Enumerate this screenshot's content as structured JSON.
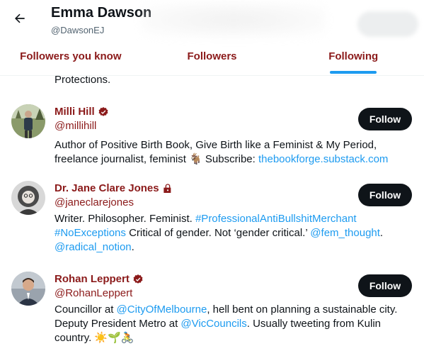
{
  "header": {
    "title": "Emma Dawson",
    "handle": "@DawsonEJ"
  },
  "tabs": [
    {
      "label": "Followers you know",
      "active": false
    },
    {
      "label": "Followers",
      "active": false
    },
    {
      "label": "Following",
      "active": true
    }
  ],
  "list": {
    "continued_text": "Protections.",
    "users": [
      {
        "name": "Milli Hill",
        "handle": "@millihill",
        "badge": "verified-icon",
        "follow_label": "Follow",
        "bio": {
          "text1": "Author of Positive Birth Book, Give Birth like a Feminist & My Period,",
          "text2": "freelance journalist, feminist 🐐 Subscribe: ",
          "link1": "thebookforge.substack.com"
        }
      },
      {
        "name": "Dr. Jane Clare Jones",
        "handle": "@janeclarejones",
        "badge": "lock-icon",
        "follow_label": "Follow",
        "bio": {
          "text1": "Writer. Philosopher. Feminist. ",
          "link1": "#ProfessionalAntiBullshitMerchant",
          "link2": "#NoExceptions",
          "text2": " Critical of gender. Not ‘gender critical.’ ",
          "link3": "@fem_thought",
          "text3": ".",
          "link4": "@radical_notion",
          "text4": "."
        }
      },
      {
        "name": "Rohan Leppert",
        "handle": "@RohanLeppert",
        "badge": "verified-icon",
        "follow_label": "Follow",
        "bio": {
          "text1": "Councillor at ",
          "link1": "@CityOfMelbourne",
          "text2": ", hell bent on planning a sustainable city.",
          "text3": "Deputy President Metro at ",
          "link2": "@VicCouncils",
          "text4": ". Usually tweeting from Kulin",
          "text5": "country. ☀️🌱🚴"
        }
      }
    ]
  },
  "colors": {
    "accent": "#1d9bf0",
    "name_red": "#8b1a1a",
    "button": "#0f1419"
  }
}
